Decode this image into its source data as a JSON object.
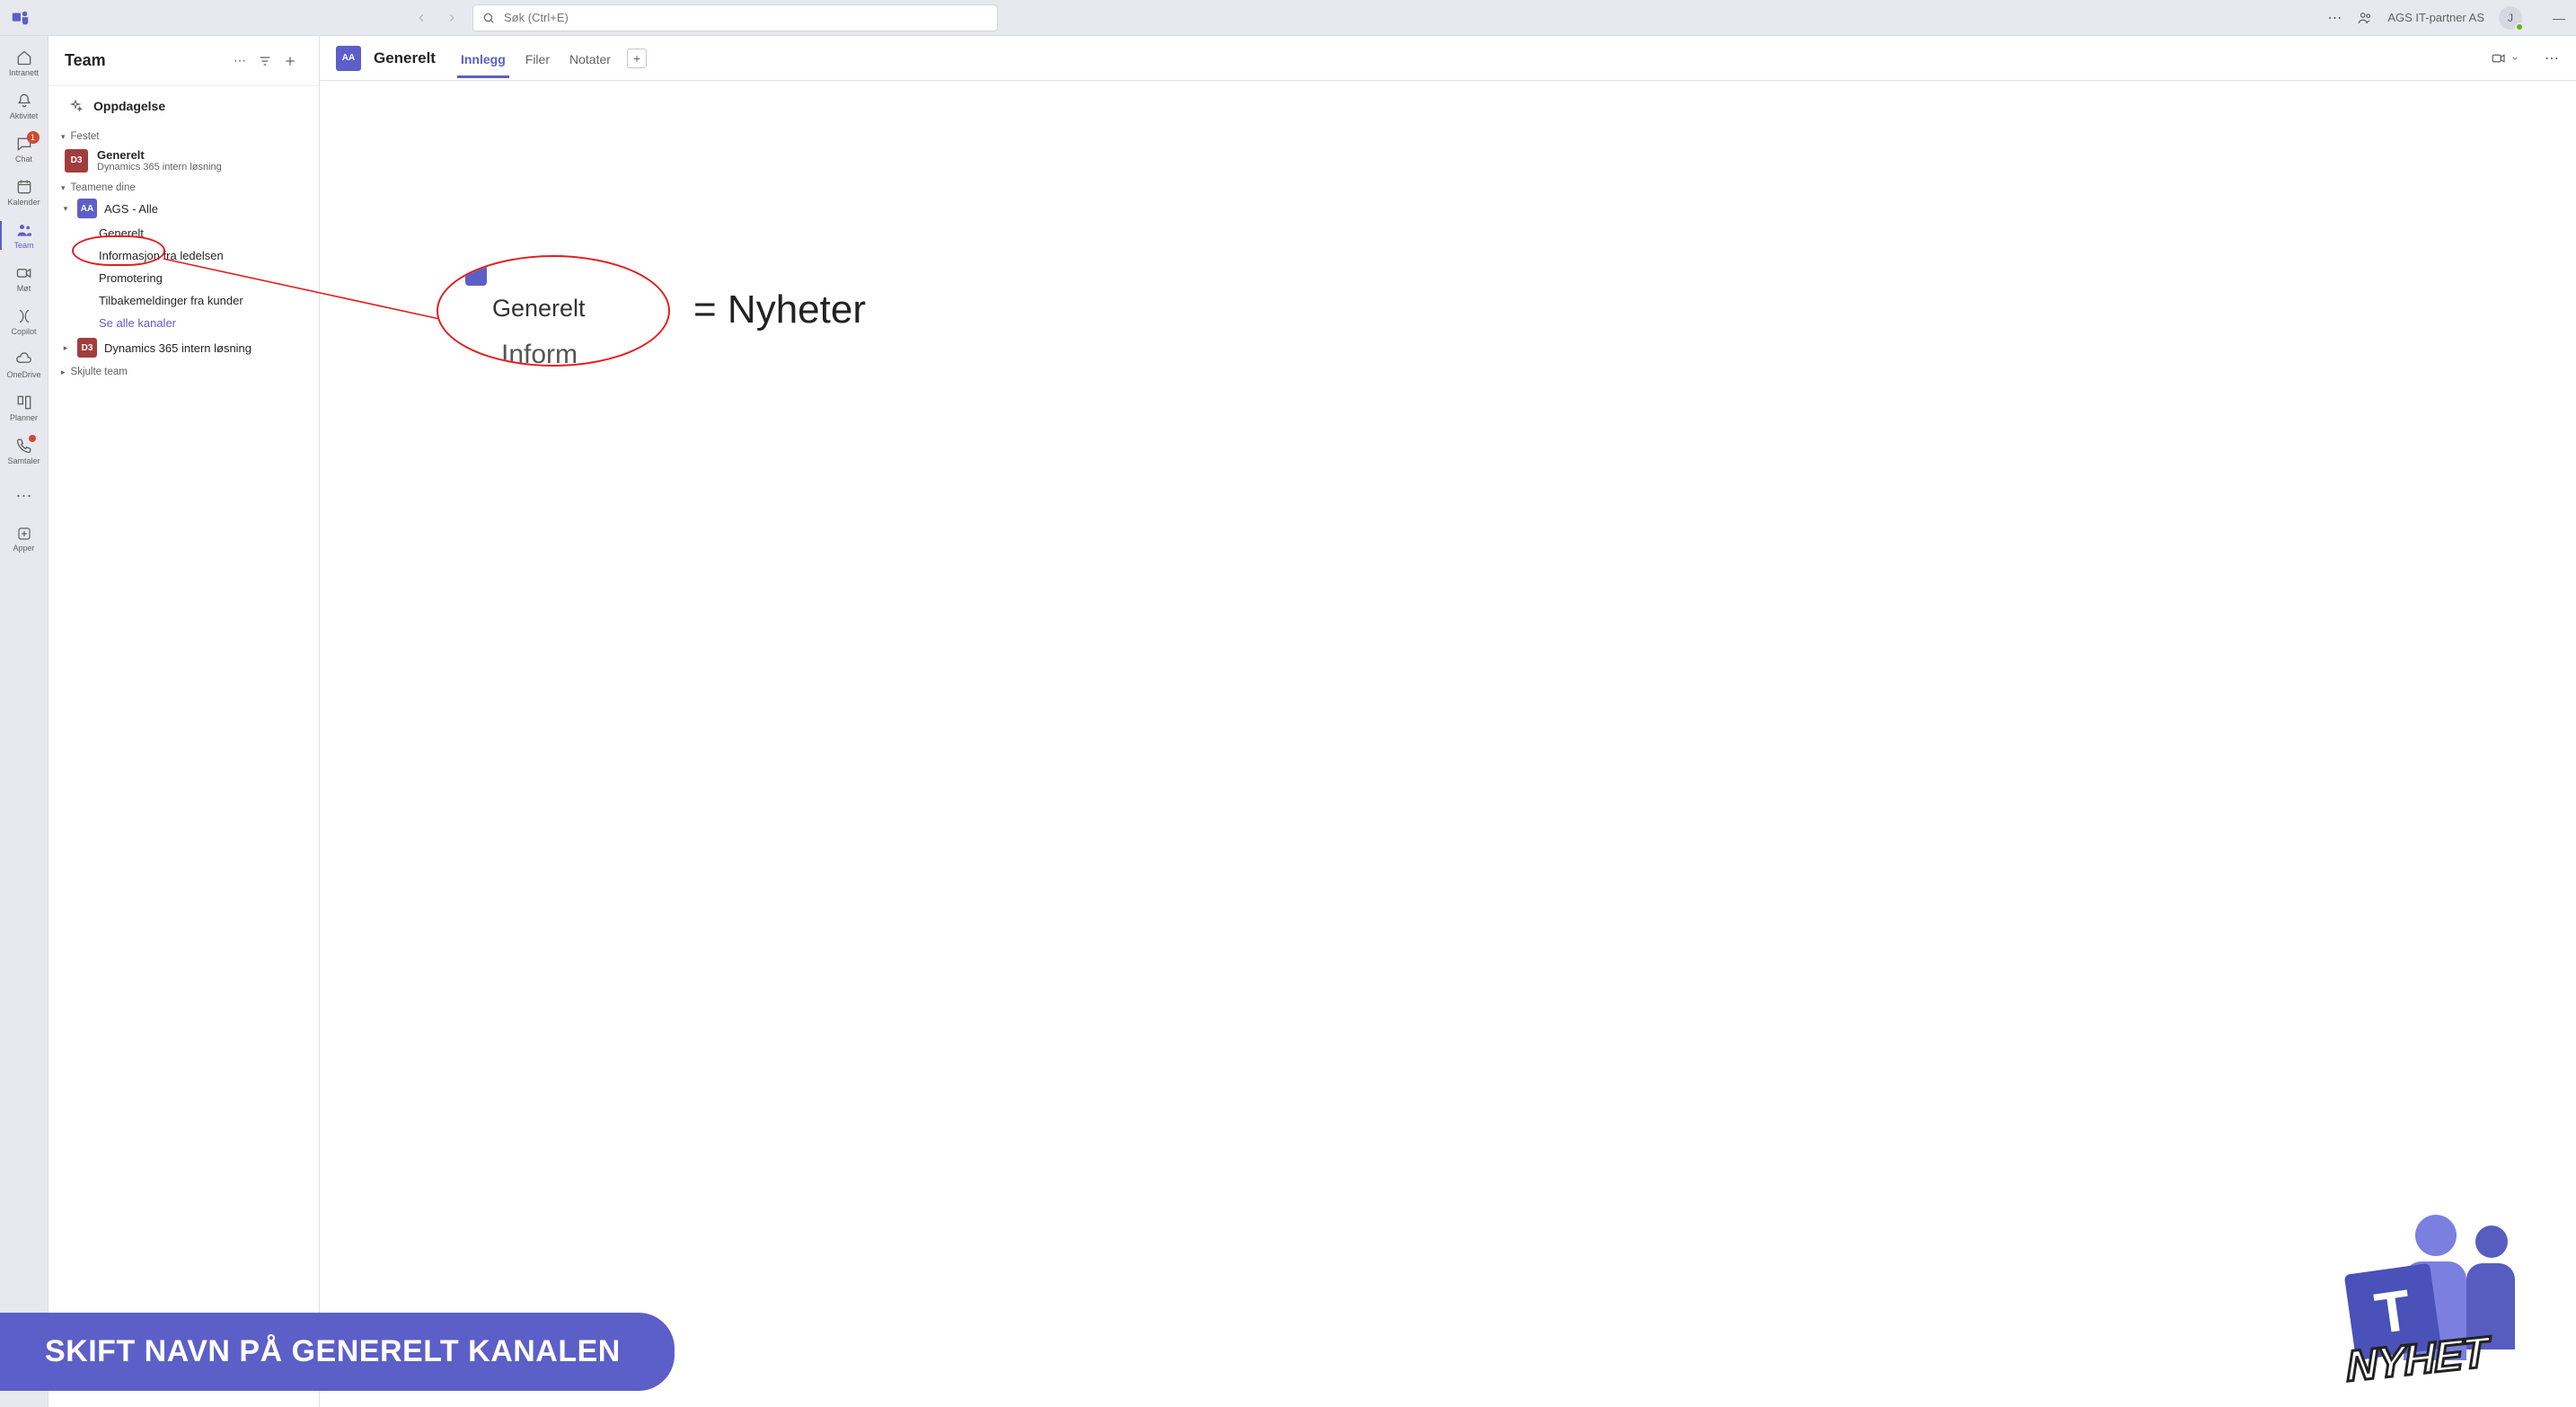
{
  "search": {
    "placeholder": "Søk (Ctrl+E)"
  },
  "org": "AGS IT-partner AS",
  "avatar_initial": "J",
  "apprail": [
    {
      "key": "intranett",
      "label": "Intranett"
    },
    {
      "key": "aktivitet",
      "label": "Aktivitet"
    },
    {
      "key": "chat",
      "label": "Chat",
      "badge": "1"
    },
    {
      "key": "kalender",
      "label": "Kalender"
    },
    {
      "key": "team",
      "label": "Team",
      "active": true
    },
    {
      "key": "mot",
      "label": "Møt"
    },
    {
      "key": "copilot",
      "label": "Copilot"
    },
    {
      "key": "onedrive",
      "label": "OneDrive"
    },
    {
      "key": "planner",
      "label": "Planner"
    },
    {
      "key": "samtaler",
      "label": "Samtaler",
      "dot": true
    }
  ],
  "apprail_apps": "Apper",
  "teamlist": {
    "title": "Team",
    "discover_label": "Oppdagelse",
    "sections": {
      "pinned_title": "Festet",
      "your_teams_title": "Teamene dine",
      "hidden_teams_title": "Skjulte team"
    },
    "pinned": {
      "avatar": "D3",
      "name": "Generelt",
      "sub": "Dynamics 365 intern løsning"
    },
    "teams": [
      {
        "avatar": "AA",
        "avatar_class": "blue",
        "name": "AGS - Alle",
        "expanded": true,
        "channels": [
          {
            "name": "Generelt",
            "selected": true
          },
          {
            "name": "Informasjon fra ledelsen"
          },
          {
            "name": "Promotering"
          },
          {
            "name": "Tilbakemeldinger fra kunder"
          },
          {
            "name": "Se alle kanaler",
            "link": true
          }
        ]
      },
      {
        "avatar": "D3",
        "avatar_class": "deep",
        "name": "Dynamics 365 intern løsning",
        "expanded": false
      }
    ]
  },
  "main": {
    "avatar": "AA",
    "title": "Generelt",
    "tabs": [
      {
        "label": "Innlegg",
        "active": true
      },
      {
        "label": "Filer"
      },
      {
        "label": "Notater"
      }
    ]
  },
  "annotation": {
    "zoom_top_fragment": "",
    "zoom_main": "Generelt",
    "zoom_bottom_fragment": "Inform",
    "equals_text": "= Nyheter"
  },
  "banner": "SKIFT NAVN PÅ GENERELT KANALEN",
  "nyhet": {
    "T": "T",
    "word": "NYHET"
  }
}
